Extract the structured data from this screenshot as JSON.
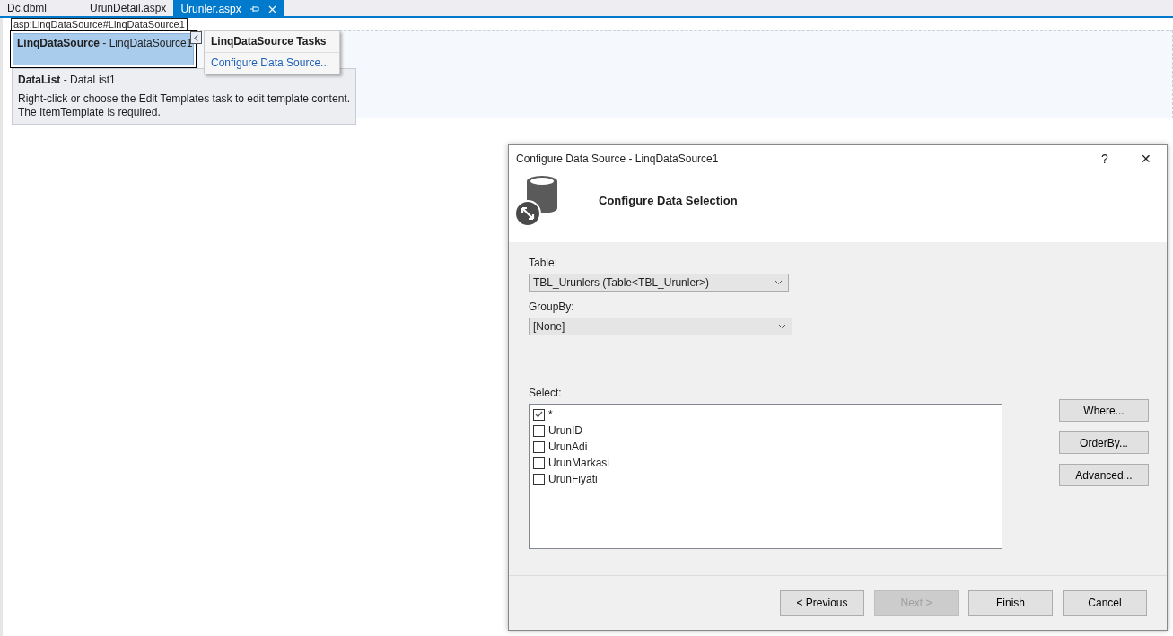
{
  "tabs": [
    {
      "label": "Dc.dbml",
      "selected": false
    },
    {
      "label": "UrunDetail.aspx",
      "selected": false
    },
    {
      "label": "Urunler.aspx",
      "selected": true
    }
  ],
  "designer": {
    "control_tag": "asp:LinqDataSource#LinqDataSource1",
    "linq_control": {
      "type": "LinqDataSource",
      "id": "- LinqDataSource1"
    },
    "smart_tag": {
      "title": "LinqDataSource Tasks",
      "link": "Configure Data Source..."
    },
    "datalist": {
      "type": "DataList",
      "id": "- DataList1",
      "message": "Right-click or choose the Edit Templates task to edit template content.\nThe ItemTemplate is required."
    }
  },
  "dialog": {
    "title": "Configure Data Source - LinqDataSource1",
    "help": "?",
    "close": "✕",
    "heading": "Configure Data Selection",
    "table_label": "Table:",
    "table_value": "TBL_Urunlers (Table<TBL_Urunler>)",
    "groupby_label": "GroupBy:",
    "groupby_value": "[None]",
    "select_label": "Select:",
    "fields": [
      {
        "label": "*",
        "checked": true
      },
      {
        "label": "UrunID",
        "checked": false
      },
      {
        "label": "UrunAdi",
        "checked": false
      },
      {
        "label": "UrunMarkasi",
        "checked": false
      },
      {
        "label": "UrunFiyati",
        "checked": false
      }
    ],
    "side_buttons": [
      "Where...",
      "OrderBy...",
      "Advanced..."
    ],
    "footer_buttons": [
      {
        "label": "< Previous",
        "disabled": false
      },
      {
        "label": "Next >",
        "disabled": true
      },
      {
        "label": "Finish",
        "disabled": false
      },
      {
        "label": "Cancel",
        "disabled": false
      }
    ]
  }
}
